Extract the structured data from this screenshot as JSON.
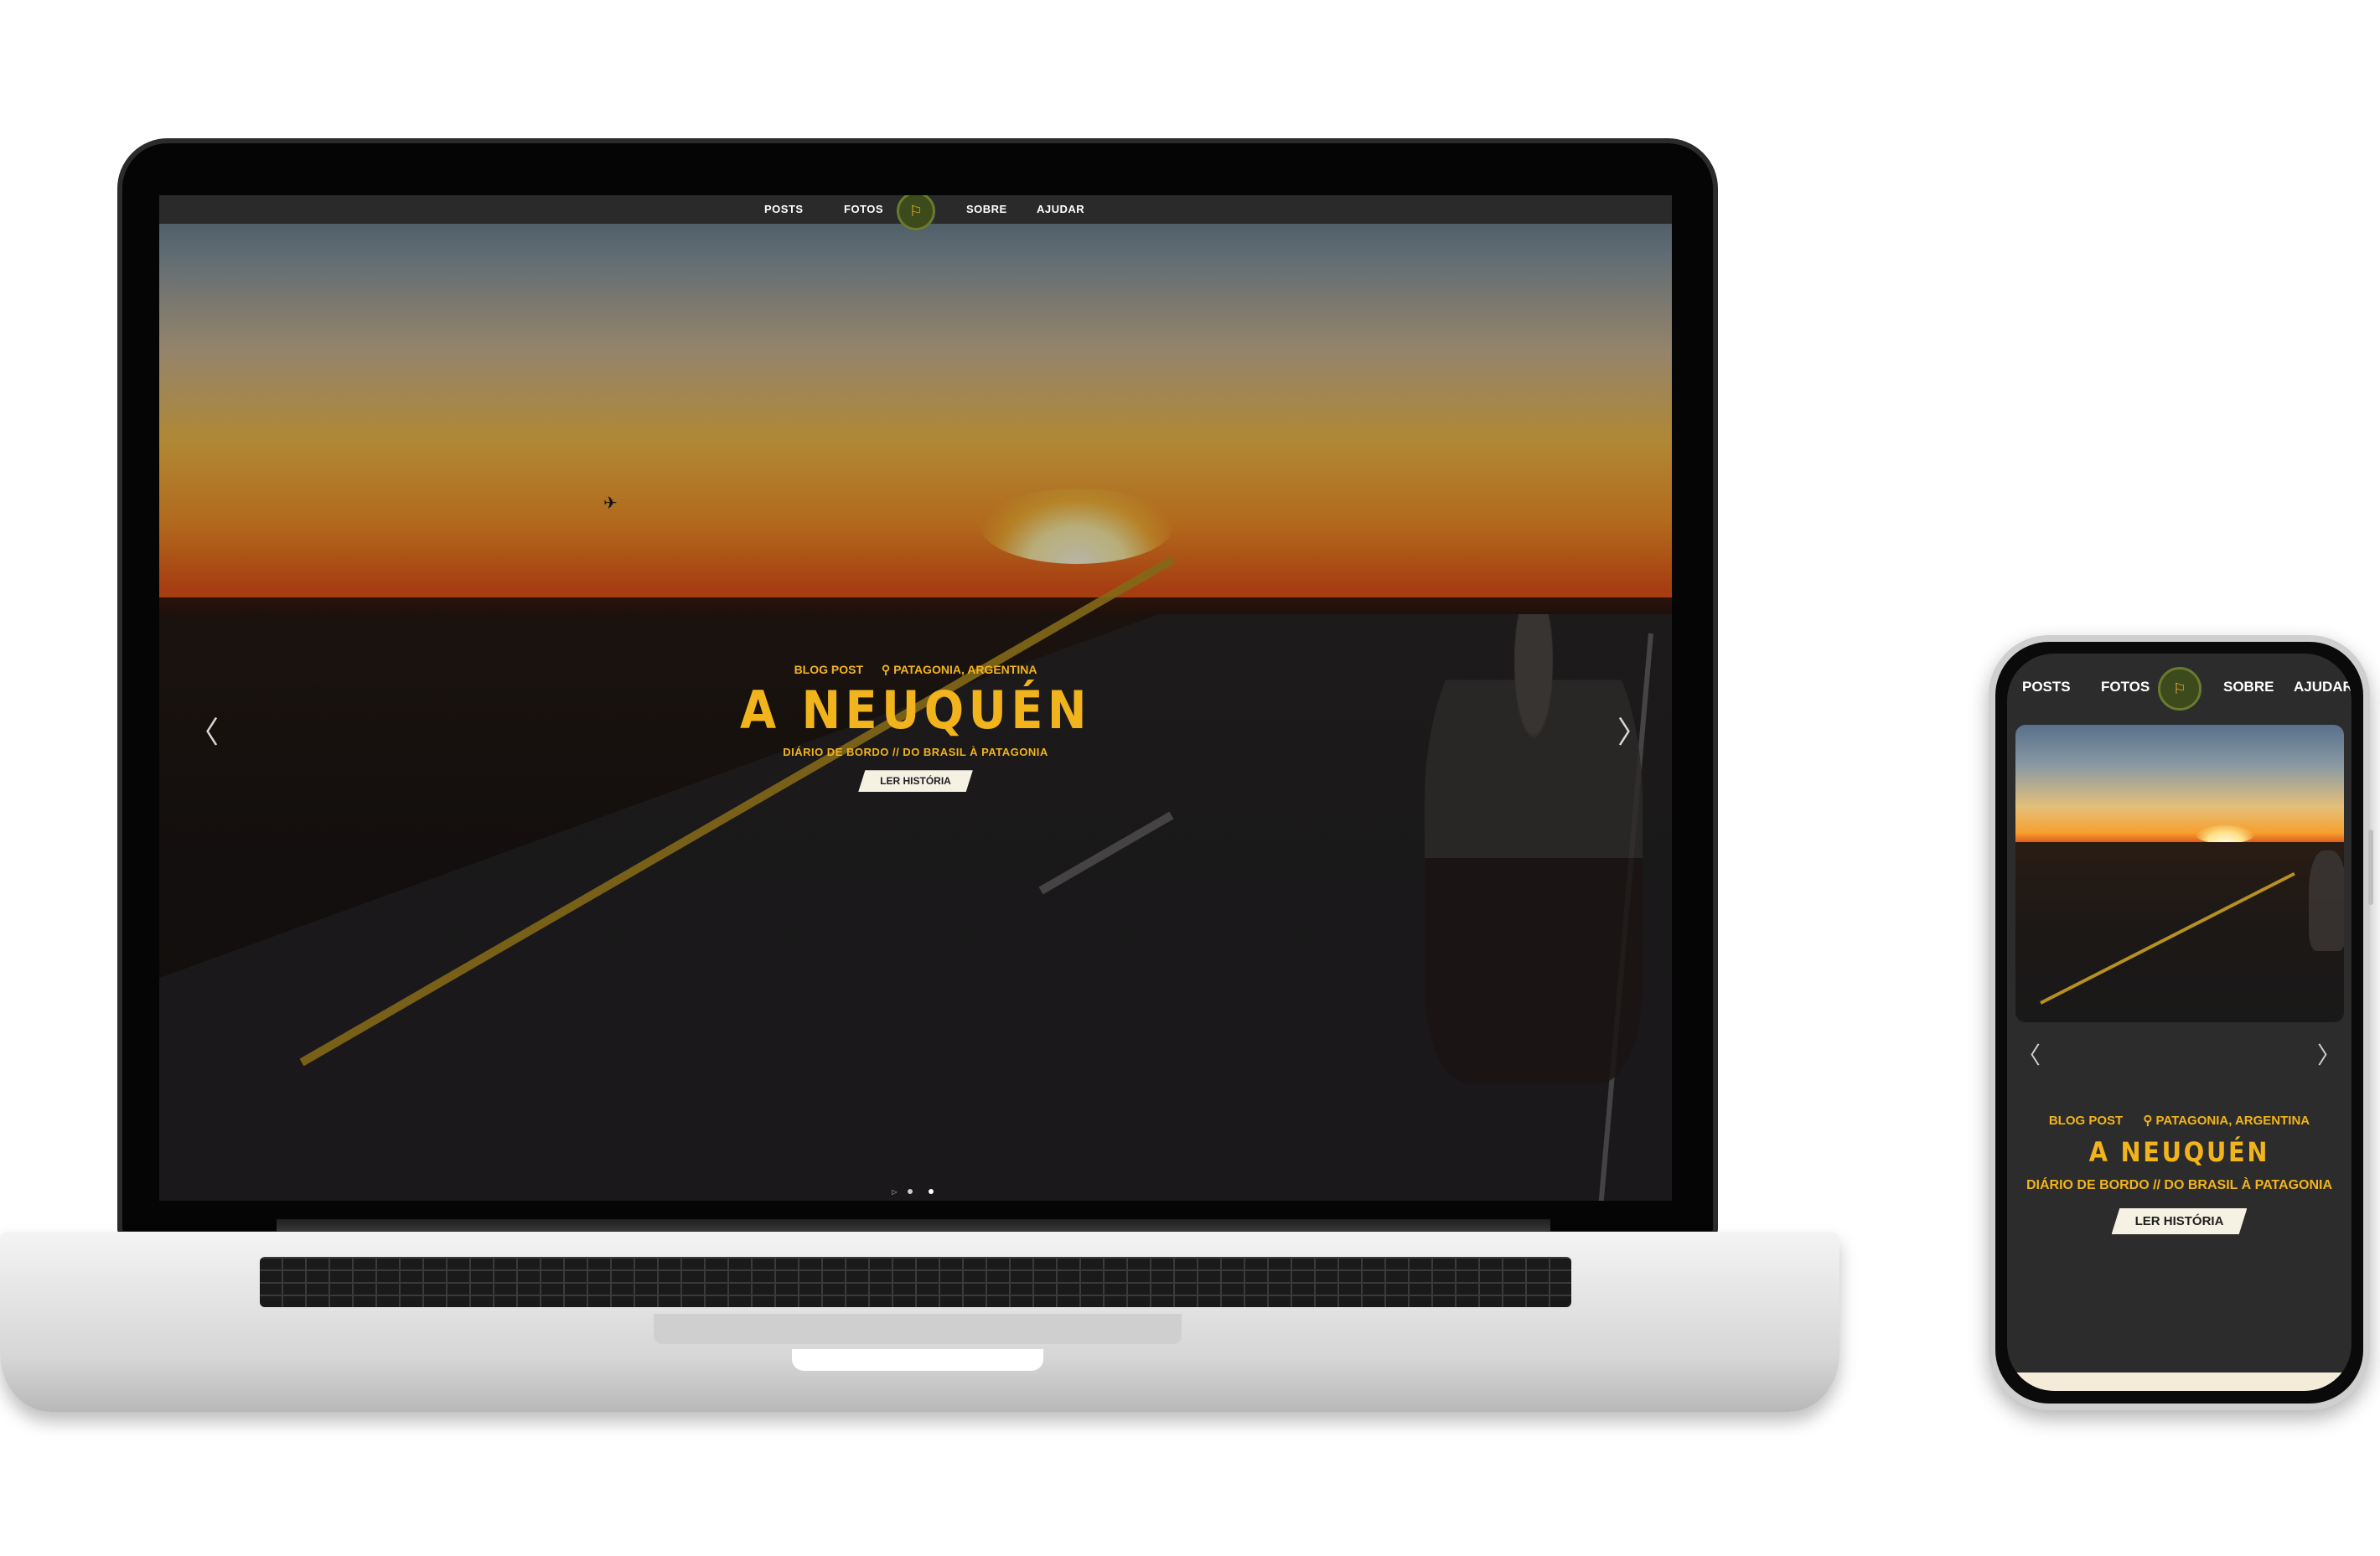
{
  "nav": {
    "posts": "POSTS",
    "fotos": "FOTOS",
    "sobre": "SOBRE",
    "ajudar": "AJUDAR",
    "logo_glyph": "⚐"
  },
  "hero": {
    "category": "BLOG POST",
    "location_icon": "map-pin-icon",
    "location": "PATAGONIA, ARGENTINA",
    "title": "A NEUQUÉN",
    "subtitle": "DIÁRIO DE BORDO // DO BRASIL À PATAGONIA",
    "button": "LER HISTÓRIA"
  },
  "slider": {
    "prev_glyph": "〈",
    "next_glyph": "〉",
    "dots": 2,
    "active_dot": 1
  },
  "colors": {
    "accent": "#f2b41d",
    "nav_bg": "#2a2a2a",
    "button_bg": "#f5f1e3",
    "logo_bg": "#3d4a1c"
  }
}
